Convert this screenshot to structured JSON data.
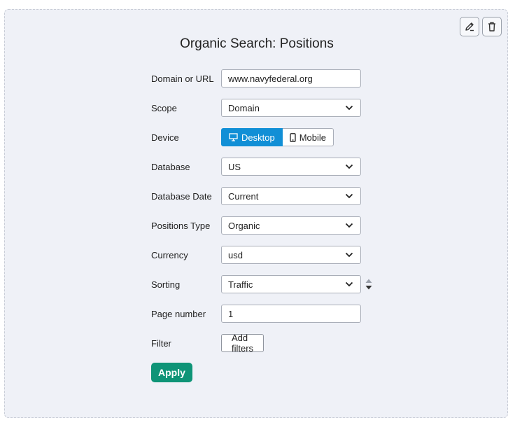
{
  "title": "Organic Search: Positions",
  "toolbar": {
    "edit_icon": "pencil-icon",
    "delete_icon": "trash-icon"
  },
  "form": {
    "domain": {
      "label": "Domain or URL",
      "value": "www.navyfederal.org"
    },
    "scope": {
      "label": "Scope",
      "value": "Domain"
    },
    "device": {
      "label": "Device",
      "options": [
        "Desktop",
        "Mobile"
      ],
      "selected": "Desktop"
    },
    "database": {
      "label": "Database",
      "value": "US"
    },
    "database_date": {
      "label": "Database Date",
      "value": "Current"
    },
    "positions_type": {
      "label": "Positions Type",
      "value": "Organic"
    },
    "currency": {
      "label": "Currency",
      "value": "usd"
    },
    "sorting": {
      "label": "Sorting",
      "value": "Traffic"
    },
    "page_number": {
      "label": "Page number",
      "value": "1"
    },
    "filter": {
      "label": "Filter",
      "button": "Add filters"
    }
  },
  "apply_label": "Apply",
  "colors": {
    "accent_blue": "#118fd6",
    "apply_green": "#0e9477",
    "panel_bg": "#eff1f7"
  }
}
